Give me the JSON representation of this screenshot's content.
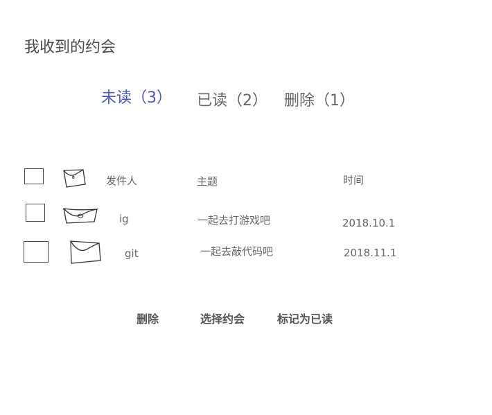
{
  "page": {
    "title": "我收到的约会"
  },
  "tabs": [
    {
      "label": "未读（3）",
      "active": true
    },
    {
      "label": "已读（2）",
      "active": false
    },
    {
      "label": "删除（1）",
      "active": false
    }
  ],
  "table": {
    "headers": {
      "sender": "发件人",
      "subject": "主题",
      "time": "时间"
    },
    "rows": [
      {
        "sender": "ig",
        "subject": "一起去打游戏吧",
        "time": "2018.10.1"
      },
      {
        "sender": "git",
        "subject": "一起去敲代码吧",
        "time": "2018.11.1"
      }
    ]
  },
  "actions": {
    "delete": "删除",
    "select": "选择约会",
    "mark_read": "标记为已读"
  },
  "colors": {
    "active_tab": "#4b55c8",
    "text": "#666666"
  },
  "icons": {
    "header": "envelope-icon",
    "row": "envelope-icon"
  }
}
